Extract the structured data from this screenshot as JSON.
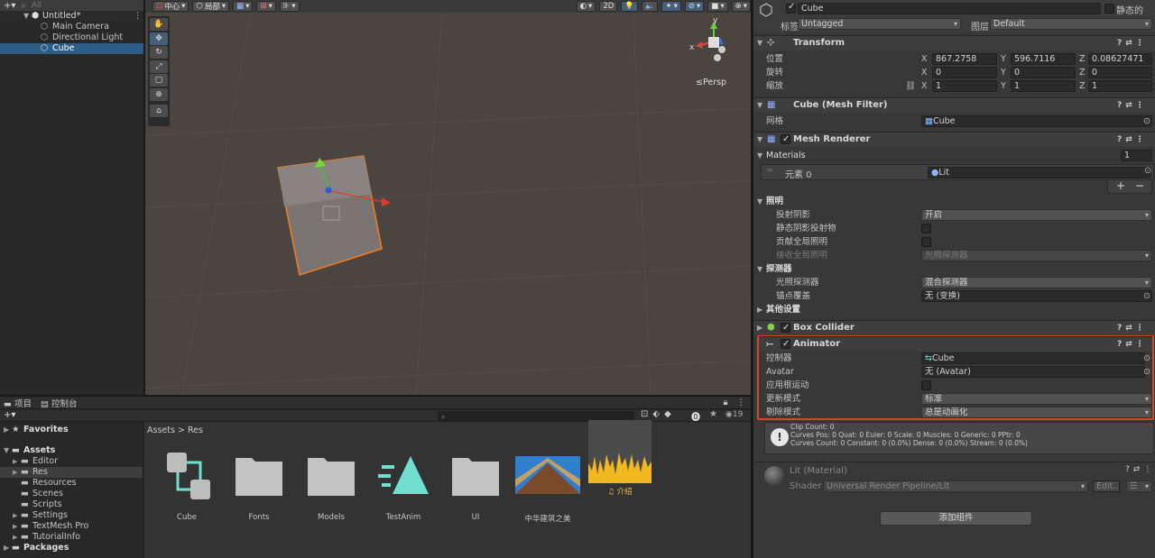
{
  "hierarchy": {
    "add_label": "+▾",
    "search_placeholder": "All",
    "scene": "Untitled*",
    "items": [
      {
        "label": "Main Camera"
      },
      {
        "label": "Directional Light"
      },
      {
        "label": "Cube"
      }
    ]
  },
  "scene_toolbar": {
    "pivot": "中心",
    "space": "局部",
    "mode_2d": "2D",
    "persp": "≤Persp",
    "gizmo_y": "y",
    "gizmo_x": "x"
  },
  "inspector": {
    "object_name": "Cube",
    "static_label": "静态的",
    "tag_label": "标签",
    "tag_value": "Untagged",
    "layer_label": "图层",
    "layer_value": "Default",
    "transform": {
      "title": "Transform",
      "rows": [
        {
          "label": "位置",
          "x": "867.2758",
          "y": "596.7116",
          "z": "0.08627471"
        },
        {
          "label": "旋转",
          "x": "0",
          "y": "0",
          "z": "0"
        },
        {
          "label": "缩放",
          "x": "1",
          "y": "1",
          "z": "1"
        }
      ],
      "axis_x": "X",
      "axis_y": "Y",
      "axis_z": "Z"
    },
    "mesh_filter": {
      "title": "Cube (Mesh Filter)",
      "mesh_label": "网格",
      "mesh_value": "Cube"
    },
    "mesh_renderer": {
      "title": "Mesh Renderer",
      "materials_label": "Materials",
      "materials_count": "1",
      "element_label": "元素 0",
      "element_value": "Lit",
      "plus": "+",
      "minus": "−",
      "lighting_label": "照明",
      "cast_shadows_label": "投射阴影",
      "cast_shadows_value": "开启",
      "static_shadow_label": "静态阴影投射物",
      "gi_label": "贡献全局照明",
      "receive_gi_label": "接收全局照明",
      "receive_gi_value": "光照探测器",
      "probes_label": "探测器",
      "light_probes_label": "光照探测器",
      "light_probes_value": "混合探测器",
      "anchor_label": "锚点覆盖",
      "anchor_value": "无 (变换)",
      "other_label": "其他设置"
    },
    "box_collider": {
      "title": "Box Collider"
    },
    "animator": {
      "title": "Animator",
      "controller_label": "控制器",
      "controller_value": "Cube",
      "avatar_label": "Avatar",
      "avatar_value": "无 (Avatar)",
      "root_motion_label": "应用根运动",
      "update_label": "更新模式",
      "update_value": "标准",
      "culling_label": "剔除模式",
      "culling_value": "总是动画化",
      "info_line1": "Clip Count: 0",
      "info_line2": "Curves Pos: 0 Quat: 0 Euler: 0 Scale: 0 Muscles: 0 Generic: 0 PPtr: 0",
      "info_line3": "Curves Count: 0 Constant: 0 (0.0%) Dense: 0 (0.0%) Stream: 0 (0.0%)",
      "info_icon": "!"
    },
    "material": {
      "title": "Lit (Material)",
      "shader_label": "Shader",
      "shader_value": "Universal Render Pipeline/Lit",
      "edit_label": "Edit...",
      "list_label": "☰"
    },
    "add_component": "添加组件"
  },
  "project": {
    "tab_project": "项目",
    "tab_console": "控制台",
    "add_label": "+▾",
    "favorites": "Favorites",
    "assets_root": "Assets",
    "tree": [
      {
        "label": "Editor",
        "arrow": true
      },
      {
        "label": "Res",
        "arrow": true,
        "selected": true
      },
      {
        "label": "Resources",
        "arrow": false
      },
      {
        "label": "Scenes",
        "arrow": false
      },
      {
        "label": "Scripts",
        "arrow": false
      },
      {
        "label": "Settings",
        "arrow": true
      },
      {
        "label": "TextMesh Pro",
        "arrow": true
      },
      {
        "label": "TutorialInfo",
        "arrow": true
      }
    ],
    "packages": "Packages",
    "breadcrumb_assets": "Assets",
    "breadcrumb_sep": ">",
    "breadcrumb_res": "Res",
    "count": "19",
    "items": [
      {
        "label": "Cube",
        "kind": "controller"
      },
      {
        "label": "Fonts",
        "kind": "folder"
      },
      {
        "label": "Models",
        "kind": "folder"
      },
      {
        "label": "TestAnim",
        "kind": "anim"
      },
      {
        "label": "UI",
        "kind": "folder"
      },
      {
        "label": "中华建筑之美",
        "kind": "image"
      },
      {
        "label": "♫ 介绍",
        "kind": "audio"
      }
    ]
  },
  "colors": {
    "accent": "#2c5d87",
    "highlight": "#d2472c",
    "cube_outline": "#f07b22",
    "controller_icon": "#6fe0cf"
  }
}
